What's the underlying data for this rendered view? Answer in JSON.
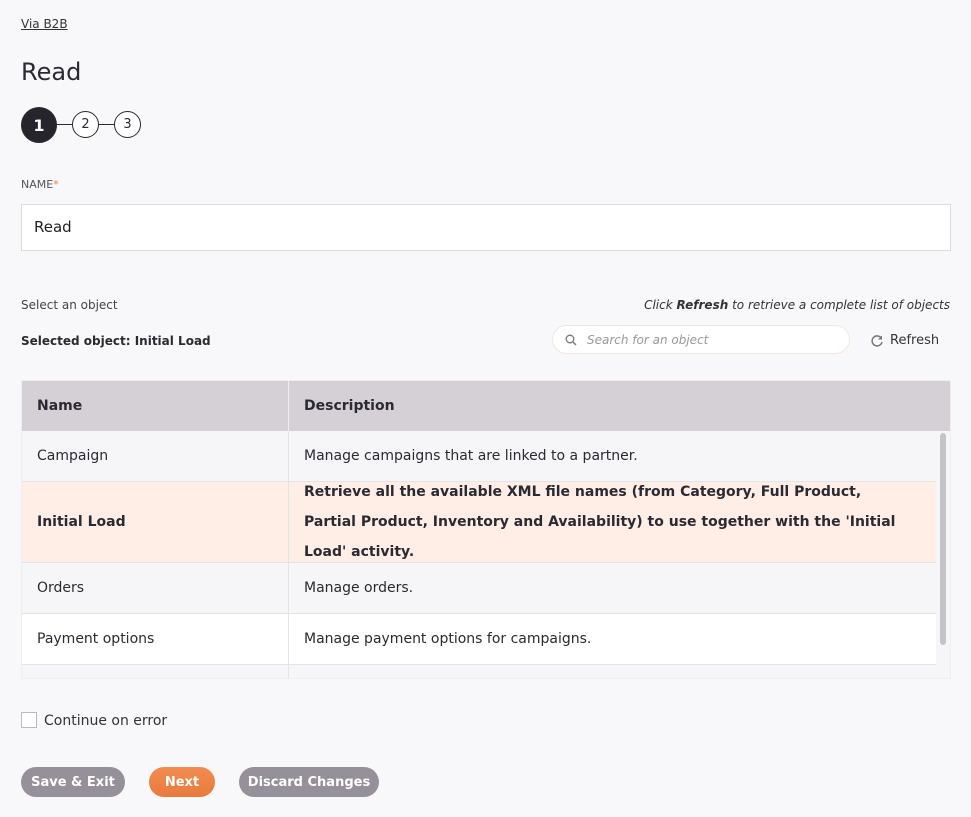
{
  "breadcrumb": "Via B2B",
  "title": "Read",
  "steps": [
    "1",
    "2",
    "3"
  ],
  "name_label": "NAME",
  "required_mark": "*",
  "name_value": "Read",
  "select_label": "Select an object",
  "hint": {
    "pre": "Click ",
    "bold": "Refresh",
    "post": " to retrieve a complete list of objects"
  },
  "selected_object": "Selected object: Initial Load",
  "search_placeholder": "Search for an object",
  "refresh_label": "Refresh",
  "table": {
    "headers": [
      "Name",
      "Description"
    ],
    "rows": [
      {
        "name": "Campaign",
        "description": "Manage campaigns that are linked to a partner."
      },
      {
        "name": "Initial Load",
        "description": "Retrieve all the available XML file names (from Category, Full Product, Partial Product, Inventory and Availability) to use together with the 'Initial Load' activity."
      },
      {
        "name": "Orders",
        "description": "Manage orders."
      },
      {
        "name": "Payment options",
        "description": "Manage payment options for campaigns."
      }
    ]
  },
  "continue_on_error": "Continue on error",
  "buttons": {
    "save_exit": "Save & Exit",
    "next": "Next",
    "discard": "Discard Changes"
  },
  "colors": {
    "accent": "#ef8040",
    "selected_row": "#ffeee6",
    "header": "#d5d0d6",
    "gray_button": "#96909a"
  }
}
